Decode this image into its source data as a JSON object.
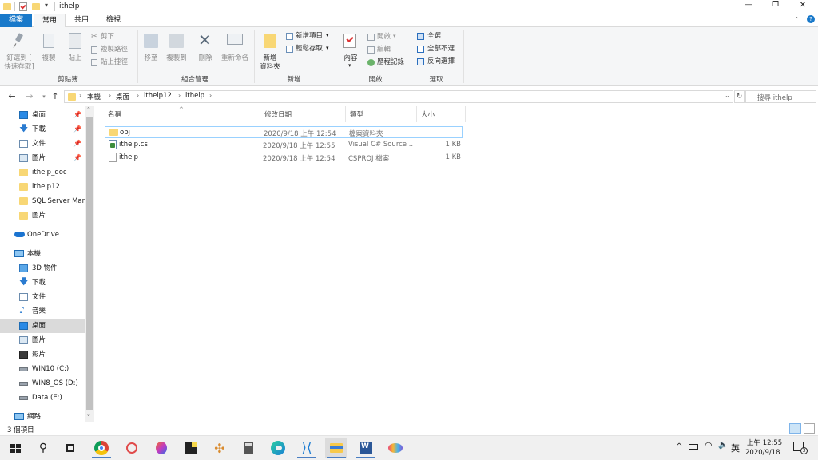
{
  "window": {
    "title": "ithelp",
    "controls": {
      "minimize": "—",
      "maximize": "❐",
      "close": "✕"
    }
  },
  "ribbon_tabs": [
    "檔案",
    "常用",
    "共用",
    "檢視"
  ],
  "ribbon": {
    "clipboard": {
      "label": "剪貼簿",
      "pin": "釘選到 [\n快速存取]",
      "copy": "複製",
      "paste": "貼上",
      "cut": "剪下",
      "copy_path": "複製路徑",
      "paste_shortcut": "貼上捷徑"
    },
    "organize": {
      "label": "組合管理",
      "move_to": "移至",
      "copy_to": "複製到",
      "delete": "刪除",
      "rename": "重新命名"
    },
    "new": {
      "label": "新增",
      "new_folder": "新增\n資料夾",
      "new_item": "新增項目",
      "easy_access": "輕鬆存取"
    },
    "open": {
      "label": "開啟",
      "properties": "內容",
      "open": "開啟",
      "edit": "編輯",
      "history": "歷程記錄"
    },
    "select": {
      "label": "選取",
      "select_all": "全選",
      "select_none": "全部不選",
      "invert": "反向選擇"
    }
  },
  "address": {
    "breadcrumb": [
      "本機",
      "桌面",
      "ithelp12",
      "ithelp"
    ],
    "search_placeholder": "搜尋 ithelp"
  },
  "nav": {
    "quick_access": [
      {
        "label": "桌面",
        "icon": "desktop-icon",
        "pinned": true
      },
      {
        "label": "下載",
        "icon": "download-icon",
        "pinned": true
      },
      {
        "label": "文件",
        "icon": "document-icon",
        "pinned": true
      },
      {
        "label": "圖片",
        "icon": "picture-icon",
        "pinned": true
      },
      {
        "label": "ithelp_doc",
        "icon": "folder-icon",
        "pinned": false
      },
      {
        "label": "ithelp12",
        "icon": "folder-icon",
        "pinned": false
      },
      {
        "label": "SQL Server Mar",
        "icon": "folder-icon",
        "pinned": false
      },
      {
        "label": "圖片",
        "icon": "folder-icon",
        "pinned": false
      }
    ],
    "onedrive": "OneDrive",
    "this_pc": "本機",
    "pc_items": [
      {
        "label": "3D 物件",
        "icon": "3d-objects-icon"
      },
      {
        "label": "下載",
        "icon": "download-icon"
      },
      {
        "label": "文件",
        "icon": "document-icon"
      },
      {
        "label": "音樂",
        "icon": "music-icon"
      },
      {
        "label": "桌面",
        "icon": "desktop-icon",
        "selected": true
      },
      {
        "label": "圖片",
        "icon": "picture-icon"
      },
      {
        "label": "影片",
        "icon": "video-icon"
      },
      {
        "label": "WIN10 (C:)",
        "icon": "drive-icon"
      },
      {
        "label": "WIN8_OS (D:)",
        "icon": "drive-icon"
      },
      {
        "label": "Data (E:)",
        "icon": "drive-icon"
      }
    ],
    "network": "網路"
  },
  "columns": [
    "名稱",
    "修改日期",
    "類型",
    "大小"
  ],
  "files": [
    {
      "name": "obj",
      "modified": "2020/9/18 上午 12:54",
      "type": "檔案資料夾",
      "size": "",
      "icon": "folder-icon",
      "selected": true
    },
    {
      "name": "ithelp.cs",
      "modified": "2020/9/18 上午 12:55",
      "type": "Visual C# Source ...",
      "size": "1 KB",
      "icon": "csharp-file-icon"
    },
    {
      "name": "ithelp",
      "modified": "2020/9/18 上午 12:54",
      "type": "CSPROJ 檔案",
      "size": "1 KB",
      "icon": "file-icon"
    }
  ],
  "status": {
    "item_count": "3 個項目"
  },
  "taskbar": {
    "ime": "英",
    "time": "上午 12:55",
    "date": "2020/9/18",
    "notification_count": "3"
  }
}
